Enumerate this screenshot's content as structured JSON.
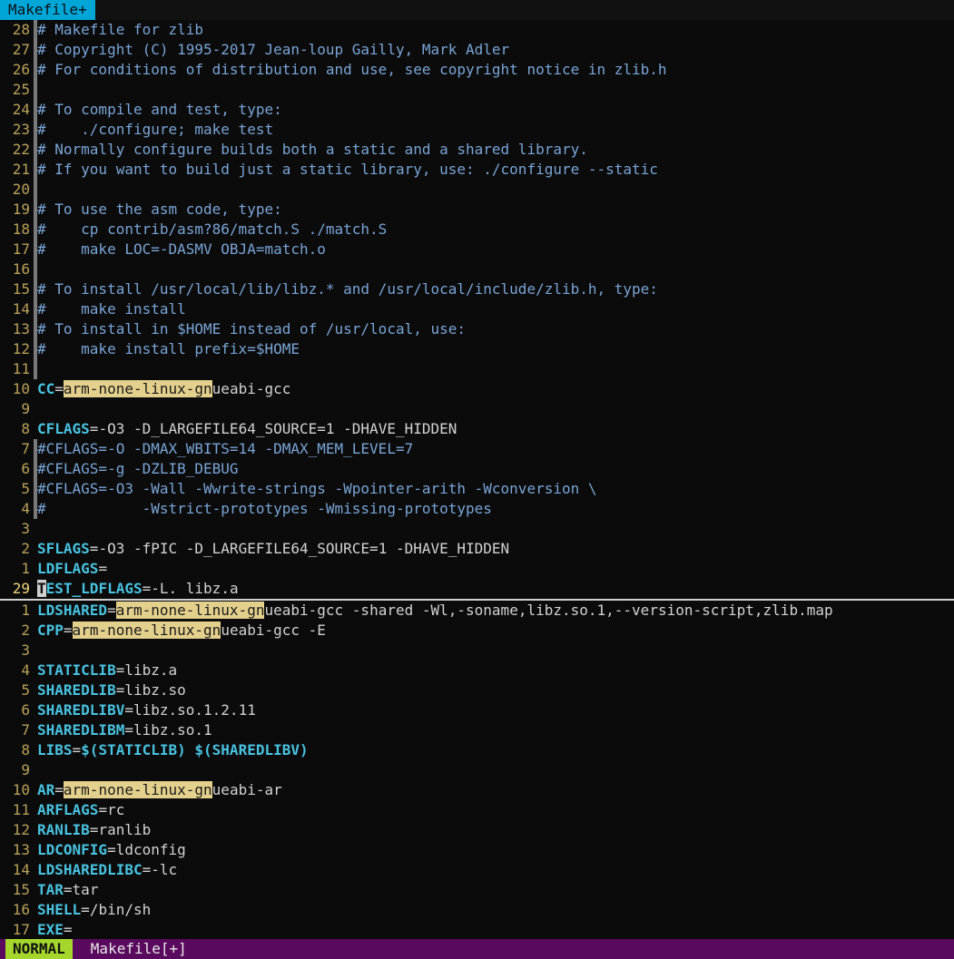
{
  "tab": {
    "label": "Makefile+"
  },
  "top_pane": [
    {
      "n": "28",
      "t": "# Makefile for zlib",
      "k": "c"
    },
    {
      "n": "27",
      "t": "# Copyright (C) 1995-2017 Jean-loup Gailly, Mark Adler",
      "k": "c"
    },
    {
      "n": "26",
      "t": "# For conditions of distribution and use, see copyright notice in zlib.h",
      "k": "c"
    },
    {
      "n": "25",
      "t": "",
      "k": "c"
    },
    {
      "n": "24",
      "t": "# To compile and test, type:",
      "k": "c"
    },
    {
      "n": "23",
      "t": "#    ./configure; make test",
      "k": "c"
    },
    {
      "n": "22",
      "t": "# Normally configure builds both a static and a shared library.",
      "k": "c"
    },
    {
      "n": "21",
      "t": "# If you want to build just a static library, use: ./configure --static",
      "k": "c"
    },
    {
      "n": "20",
      "t": "",
      "k": "c"
    },
    {
      "n": "19",
      "t": "# To use the asm code, type:",
      "k": "c"
    },
    {
      "n": "18",
      "t": "#    cp contrib/asm?86/match.S ./match.S",
      "k": "c"
    },
    {
      "n": "17",
      "t": "#    make LOC=-DASMV OBJA=match.o",
      "k": "c"
    },
    {
      "n": "16",
      "t": "",
      "k": "c"
    },
    {
      "n": "15",
      "t": "# To install /usr/local/lib/libz.* and /usr/local/include/zlib.h, type:",
      "k": "c"
    },
    {
      "n": "14",
      "t": "#    make install",
      "k": "c"
    },
    {
      "n": "13",
      "t": "# To install in $HOME instead of /usr/local, use:",
      "k": "c"
    },
    {
      "n": "12",
      "t": "#    make install prefix=$HOME",
      "k": "c"
    },
    {
      "n": "11",
      "t": "",
      "k": "c"
    },
    {
      "n": "10",
      "v": "CC",
      "eq": "=",
      "h": "arm-none-linux-gn",
      "r": "ueabi-gcc",
      "k": "n"
    },
    {
      "n": "9",
      "t": "",
      "k": "n"
    },
    {
      "n": "8",
      "v": "CFLAGS",
      "eq": "=",
      "r": "-O3 -D_LARGEFILE64_SOURCE=1 -DHAVE_HIDDEN",
      "k": "n"
    },
    {
      "n": "7",
      "t": "#CFLAGS=-O -DMAX_WBITS=14 -DMAX_MEM_LEVEL=7",
      "k": "c"
    },
    {
      "n": "6",
      "t": "#CFLAGS=-g -DZLIB_DEBUG",
      "k": "c"
    },
    {
      "n": "5",
      "t": "#CFLAGS=-O3 -Wall -Wwrite-strings -Wpointer-arith -Wconversion \\",
      "k": "c"
    },
    {
      "n": "4",
      "t": "#           -Wstrict-prototypes -Wmissing-prototypes",
      "k": "c"
    },
    {
      "n": "3",
      "t": "",
      "k": "n"
    },
    {
      "n": "2",
      "v": "SFLAGS",
      "eq": "=",
      "r": "-O3 -fPIC -D_LARGEFILE64_SOURCE=1 -DHAVE_HIDDEN",
      "k": "n"
    },
    {
      "n": "1",
      "v": "LDFLAGS",
      "eq": "=",
      "r": "",
      "k": "n"
    },
    {
      "n": "29",
      "v": "TEST_LDFLAGS",
      "eq": "=",
      "r": "-L. libz.a",
      "k": "n",
      "cur": true
    }
  ],
  "bottom_pane": [
    {
      "n": "1",
      "v": "LDSHARED",
      "eq": "=",
      "h": "arm-none-linux-gn",
      "r": "ueabi-gcc -shared -Wl,-soname,libz.so.1,--version-script,zlib.map",
      "k": "n"
    },
    {
      "n": "2",
      "v": "CPP",
      "eq": "=",
      "h": "arm-none-linux-gn",
      "r": "ueabi-gcc -E",
      "k": "n"
    },
    {
      "n": "3",
      "t": "",
      "k": "n"
    },
    {
      "n": "4",
      "v": "STATICLIB",
      "eq": "=",
      "r": "libz.a",
      "k": "n"
    },
    {
      "n": "5",
      "v": "SHAREDLIB",
      "eq": "=",
      "r": "libz.so",
      "k": "n"
    },
    {
      "n": "6",
      "v": "SHAREDLIBV",
      "eq": "=",
      "r": "libz.so.1.2.11",
      "k": "n"
    },
    {
      "n": "7",
      "v": "SHAREDLIBM",
      "eq": "=",
      "r": "libz.so.1",
      "k": "n"
    },
    {
      "n": "8",
      "v": "LIBS",
      "eq": "=",
      "r": "$(STATICLIB) $(SHAREDLIBV)",
      "k": "n",
      "bold": true
    },
    {
      "n": "9",
      "t": "",
      "k": "n"
    },
    {
      "n": "10",
      "v": "AR",
      "eq": "=",
      "h": "arm-none-linux-gn",
      "r": "ueabi-ar",
      "k": "n"
    },
    {
      "n": "11",
      "v": "ARFLAGS",
      "eq": "=",
      "r": "rc",
      "k": "n"
    },
    {
      "n": "12",
      "v": "RANLIB",
      "eq": "=",
      "r": "ranlib",
      "k": "n"
    },
    {
      "n": "13",
      "v": "LDCONFIG",
      "eq": "=",
      "r": "ldconfig",
      "k": "n"
    },
    {
      "n": "14",
      "v": "LDSHAREDLIBC",
      "eq": "=",
      "r": "-lc",
      "k": "n"
    },
    {
      "n": "15",
      "v": "TAR",
      "eq": "=",
      "r": "tar",
      "k": "n"
    },
    {
      "n": "16",
      "v": "SHELL",
      "eq": "=",
      "r": "/bin/sh",
      "k": "n"
    },
    {
      "n": "17",
      "v": "EXE",
      "eq": "=",
      "r": "",
      "k": "n"
    }
  ],
  "status": {
    "mode": "NORMAL",
    "file": "Makefile[+]"
  }
}
